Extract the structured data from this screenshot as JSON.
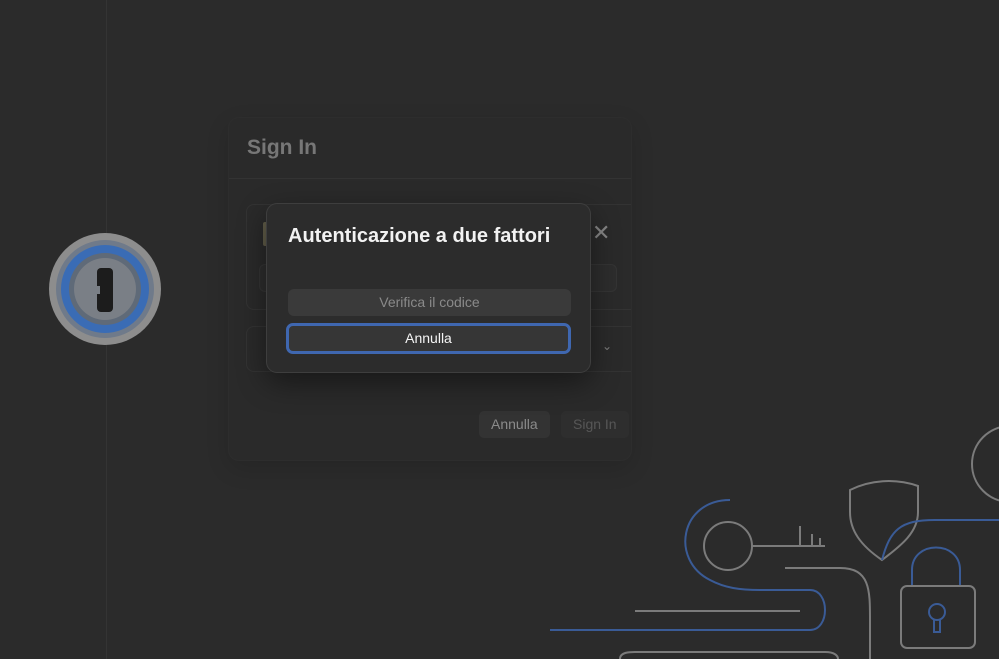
{
  "signin_sheet": {
    "title": "Sign In",
    "cancel_label": "Annulla",
    "signin_label": "Sign In"
  },
  "dialog": {
    "title": "Autenticazione a due fattori",
    "verify_label": "Verifica il codice",
    "cancel_label": "Annulla"
  },
  "icons": {
    "logo": "1password-logo-icon",
    "close": "close-icon",
    "chevron": "chevron-down-icon"
  },
  "colors": {
    "background": "#2b2b2b",
    "focus_ring": "#3f67b0",
    "logo_blue": "#2f67b8"
  }
}
